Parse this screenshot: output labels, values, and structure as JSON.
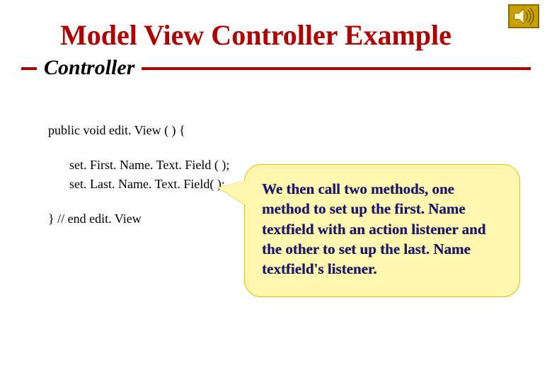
{
  "header": {
    "title": "Model View Controller Example",
    "subtitle": "Controller"
  },
  "code": {
    "line1": "public void edit. View ( ) {",
    "line2": "set. First. Name. Text. Field ( );",
    "line3": "set. Last. Name. Text. Field( );",
    "line4": "}  // end edit. View"
  },
  "callout": {
    "text": "We then call two methods, one method to set up the first. Name textfield with an action listener and the other to set up the last. Name textfield's listener."
  }
}
